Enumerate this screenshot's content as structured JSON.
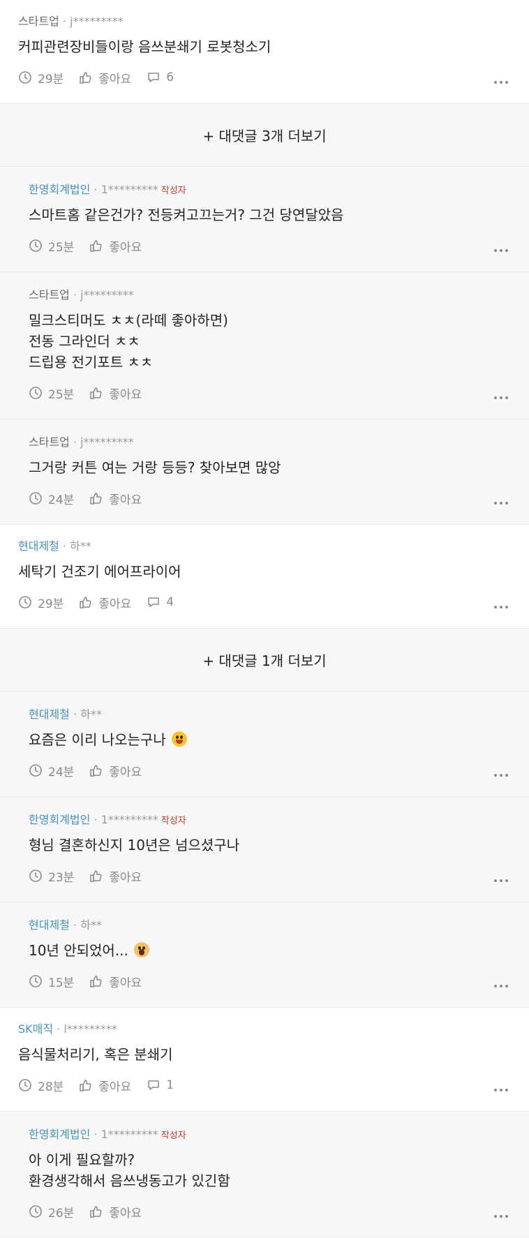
{
  "comments": [
    {
      "kind": "top",
      "company": "스타트업",
      "accent": false,
      "user": "j*********",
      "author_badge": "",
      "lines": [
        "커피관련장비들이랑 음쓰분쇄기 로봇청소기"
      ],
      "time": "29분",
      "like": "좋아요",
      "replies": "6",
      "emoji": ""
    },
    {
      "kind": "more",
      "label": "+ 대댓글 3개 더보기"
    },
    {
      "kind": "reply",
      "company": "한영회계법인",
      "accent": true,
      "user": "1*********",
      "author_badge": "작성자",
      "lines": [
        "스마트홈 같은건가? 전등켜고끄는거? 그건 당연달았음"
      ],
      "time": "25분",
      "like": "좋아요",
      "replies": "",
      "emoji": ""
    },
    {
      "kind": "reply",
      "company": "스타트업",
      "accent": false,
      "user": "j*********",
      "author_badge": "",
      "lines": [
        "밀크스티머도 ㅊㅊ(라떼 좋아하면)",
        "전동 그라인더 ㅊㅊ",
        "드립용 전기포트 ㅊㅊ"
      ],
      "time": "25분",
      "like": "좋아요",
      "replies": "",
      "emoji": ""
    },
    {
      "kind": "reply",
      "company": "스타트업",
      "accent": false,
      "user": "j*********",
      "author_badge": "",
      "lines": [
        "그거랑 커튼 여는 거랑 등등? 찾아보면 많앙"
      ],
      "time": "24분",
      "like": "좋아요",
      "replies": "",
      "emoji": ""
    },
    {
      "kind": "top",
      "company": "현대제철",
      "accent": true,
      "user": "하**",
      "author_badge": "",
      "lines": [
        "세탁기 건조기 에어프라이어"
      ],
      "time": "29분",
      "like": "좋아요",
      "replies": "4",
      "emoji": ""
    },
    {
      "kind": "more",
      "label": "+ 대댓글 1개 더보기"
    },
    {
      "kind": "reply",
      "company": "현대제철",
      "accent": true,
      "user": "하**",
      "author_badge": "",
      "lines": [
        "요즘은 이리 나오는구나"
      ],
      "time": "24분",
      "like": "좋아요",
      "replies": "",
      "emoji": "smile"
    },
    {
      "kind": "reply",
      "company": "한영회계법인",
      "accent": true,
      "user": "1*********",
      "author_badge": "작성자",
      "lines": [
        "형님 결혼하신지 10년은 넘으셨구나"
      ],
      "time": "23분",
      "like": "좋아요",
      "replies": "",
      "emoji": ""
    },
    {
      "kind": "reply",
      "company": "현대제철",
      "accent": true,
      "user": "하**",
      "author_badge": "",
      "lines": [
        "10년 안되었어..."
      ],
      "time": "15분",
      "like": "좋아요",
      "replies": "",
      "emoji": "scream"
    },
    {
      "kind": "top",
      "company": "SK매직",
      "accent": true,
      "user": "l*********",
      "author_badge": "",
      "lines": [
        "음식물처리기, 혹은 분쇄기"
      ],
      "time": "28분",
      "like": "좋아요",
      "replies": "1",
      "emoji": ""
    },
    {
      "kind": "reply",
      "company": "한영회계법인",
      "accent": true,
      "user": "1*********",
      "author_badge": "작성자",
      "lines": [
        "아 이게 필요할까?",
        "환경생각해서 음쓰냉동고가 있긴함"
      ],
      "time": "26분",
      "like": "좋아요",
      "replies": "",
      "emoji": ""
    }
  ]
}
